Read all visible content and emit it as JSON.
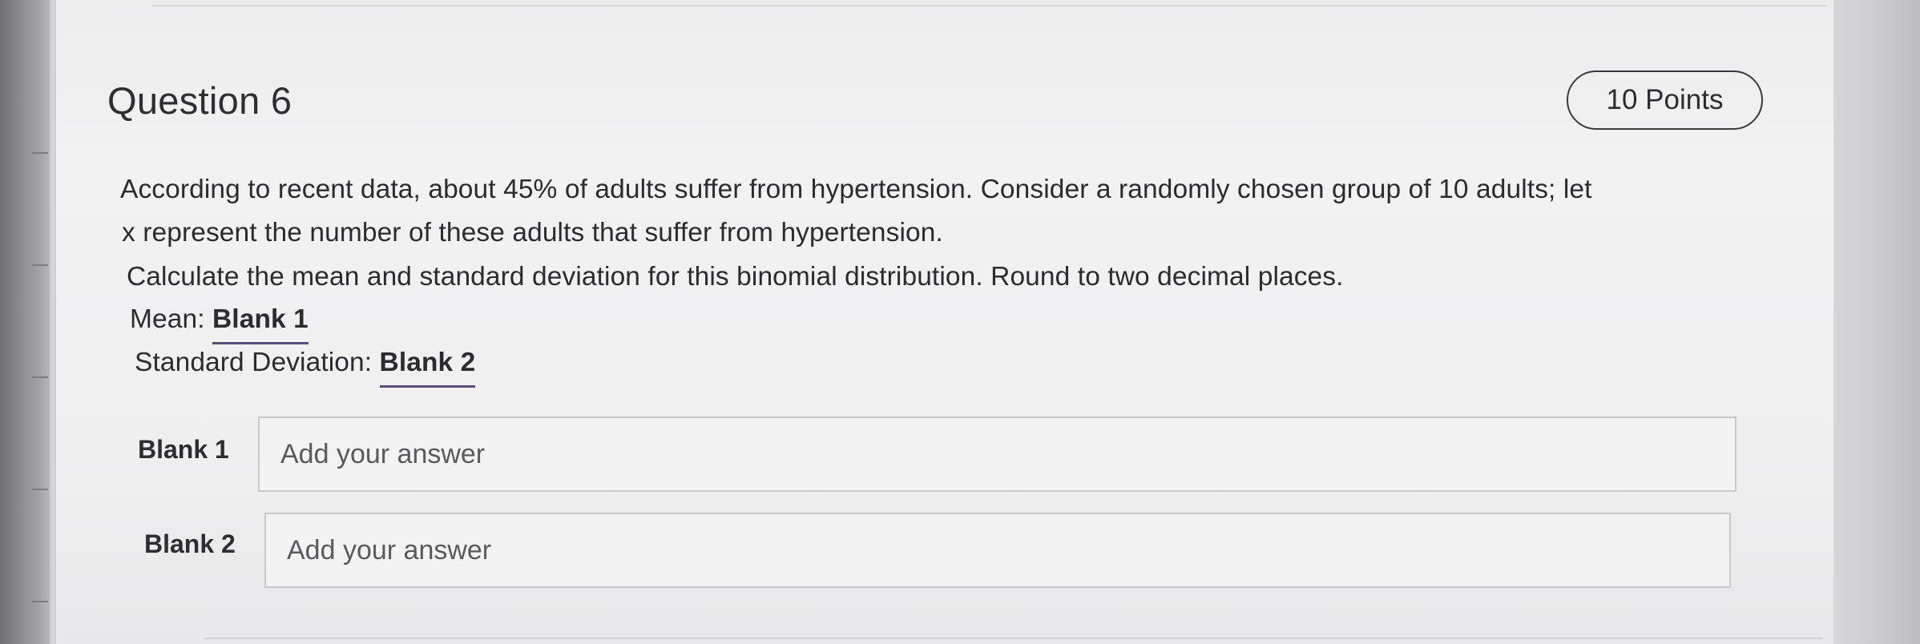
{
  "question": {
    "title": "Question 6",
    "points": "10 Points",
    "prompt_line1": "According to recent data, about 45% of adults suffer from hypertension. Consider a randomly chosen group of 10 adults; let",
    "prompt_line2": "x represent the number of these adults that suffer from hypertension.",
    "instruction": "Calculate the mean and standard deviation for this binomial distribution. Round to two decimal places.",
    "mean_label": "Mean: ",
    "mean_blank": "Blank 1",
    "sd_label": "Standard Deviation: ",
    "sd_blank": "Blank 2"
  },
  "answers": [
    {
      "label": "Blank 1",
      "placeholder": "Add your answer",
      "value": ""
    },
    {
      "label": "Blank 2",
      "placeholder": "Add your answer",
      "value": ""
    }
  ]
}
